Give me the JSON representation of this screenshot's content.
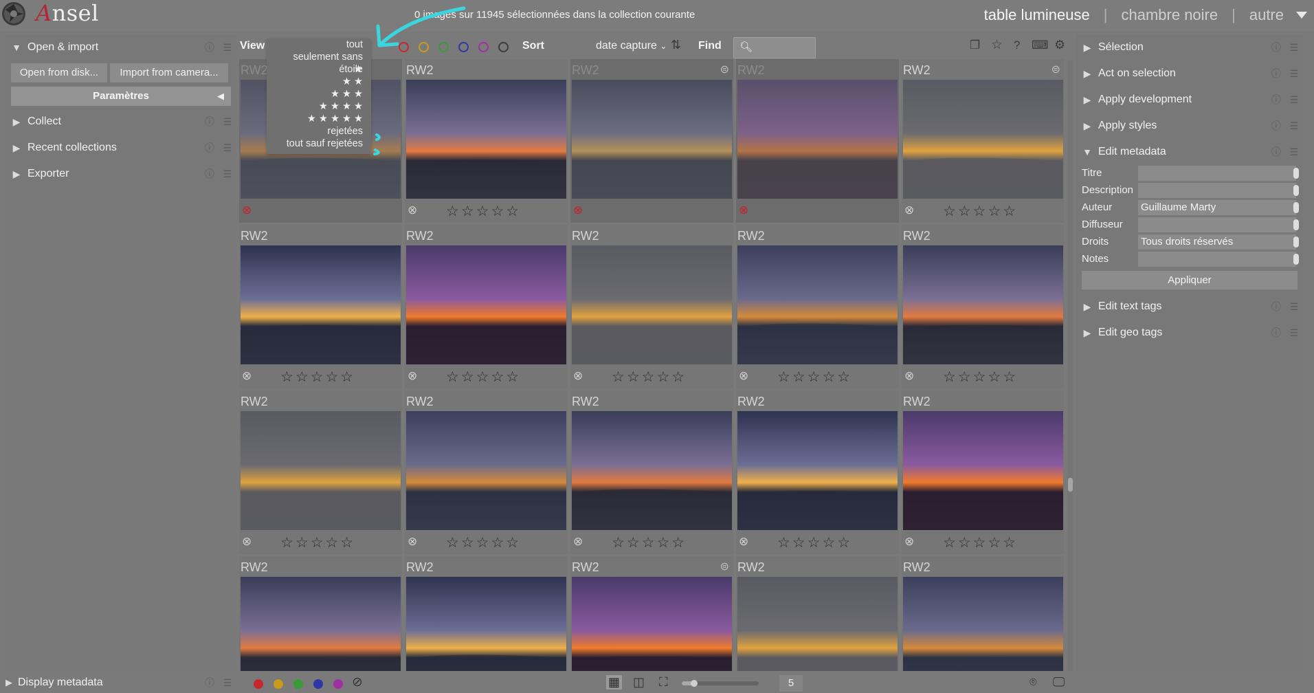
{
  "app": {
    "name_initial": "A",
    "name_rest": "nsel"
  },
  "header": {
    "status": "0 images sur 11945 sélectionnées dans la collection courante",
    "views": [
      "table lumineuse",
      "chambre noire",
      "autre"
    ],
    "separator": "|"
  },
  "left_panel": {
    "modules": [
      {
        "label": "Open & import",
        "expanded": true
      },
      {
        "label": "Collect",
        "expanded": false
      },
      {
        "label": "Recent collections",
        "expanded": false
      },
      {
        "label": "Exporter",
        "expanded": false
      }
    ],
    "buttons": {
      "open": "Open from disk...",
      "import": "Import from camera..."
    },
    "params": "Paramètres",
    "bottom_module": "Display metadata"
  },
  "toolbar": {
    "view_label": "View",
    "sort_label": "Sort",
    "sort_value": "date capture",
    "find_label": "Find",
    "search_placeholder": "",
    "color_filters": [
      "#c8262f",
      "#c99a1e",
      "#3a9a36",
      "#2e37a6",
      "#a12ea3",
      "#3b3b3b"
    ]
  },
  "view_dropdown": {
    "items": [
      "tout",
      "seulement sans étoile",
      "★",
      "★ ★",
      "★ ★ ★",
      "★ ★ ★ ★",
      "★ ★ ★ ★ ★",
      "rejetées",
      "tout sauf rejetées"
    ]
  },
  "thumbnails": [
    {
      "ext": "RW2",
      "stars": 0,
      "rejected": true,
      "dimmed": true,
      "grouped": false
    },
    {
      "ext": "RW2",
      "stars": 0,
      "rejected": false,
      "dimmed": false,
      "grouped": false
    },
    {
      "ext": "RW2",
      "stars": 0,
      "rejected": true,
      "dimmed": true,
      "grouped": true
    },
    {
      "ext": "RW2",
      "stars": 0,
      "rejected": true,
      "dimmed": true,
      "grouped": false
    },
    {
      "ext": "RW2",
      "stars": 0,
      "rejected": false,
      "dimmed": false,
      "grouped": true
    },
    {
      "ext": "RW2",
      "stars": 0,
      "rejected": false,
      "dimmed": false,
      "grouped": false
    },
    {
      "ext": "RW2",
      "stars": 0,
      "rejected": false,
      "dimmed": false,
      "grouped": false
    },
    {
      "ext": "RW2",
      "stars": 0,
      "rejected": false,
      "dimmed": false,
      "grouped": false
    },
    {
      "ext": "RW2",
      "stars": 0,
      "rejected": false,
      "dimmed": false,
      "grouped": false
    },
    {
      "ext": "RW2",
      "stars": 0,
      "rejected": false,
      "dimmed": false,
      "grouped": false
    },
    {
      "ext": "RW2",
      "stars": 0,
      "rejected": false,
      "dimmed": false,
      "grouped": false
    },
    {
      "ext": "RW2",
      "stars": 0,
      "rejected": false,
      "dimmed": false,
      "grouped": false
    },
    {
      "ext": "RW2",
      "stars": 0,
      "rejected": false,
      "dimmed": false,
      "grouped": false
    },
    {
      "ext": "RW2",
      "stars": 0,
      "rejected": false,
      "dimmed": false,
      "grouped": false
    },
    {
      "ext": "RW2",
      "stars": 0,
      "rejected": false,
      "dimmed": false,
      "grouped": false
    },
    {
      "ext": "RW2",
      "stars": 0,
      "rejected": false,
      "dimmed": false,
      "grouped": false
    },
    {
      "ext": "RW2",
      "stars": 0,
      "rejected": false,
      "dimmed": false,
      "grouped": false
    },
    {
      "ext": "RW2",
      "stars": 0,
      "rejected": false,
      "dimmed": false,
      "grouped": true
    },
    {
      "ext": "RW2",
      "stars": 0,
      "rejected": false,
      "dimmed": false,
      "grouped": false
    },
    {
      "ext": "RW2",
      "stars": 0,
      "rejected": false,
      "dimmed": false,
      "grouped": false
    }
  ],
  "right_panel": {
    "modules_top": [
      "Sélection",
      "Act on selection",
      "Apply development",
      "Apply styles"
    ],
    "metadata_module": "Edit metadata",
    "metadata_fields": [
      {
        "label": "Titre",
        "value": ""
      },
      {
        "label": "Description",
        "value": ""
      },
      {
        "label": "Auteur",
        "value": "Guillaume Marty"
      },
      {
        "label": "Diffuseur",
        "value": ""
      },
      {
        "label": "Droits",
        "value": "Tous droits réservés"
      },
      {
        "label": "Notes",
        "value": ""
      }
    ],
    "apply_label": "Appliquer",
    "modules_bottom": [
      "Edit text tags",
      "Edit geo tags"
    ]
  },
  "footer": {
    "color_labels": [
      "#c8262f",
      "#c99a1e",
      "#3a9a36",
      "#2e37a6",
      "#a12ea3"
    ],
    "zoom_value": "5",
    "zoom_fraction": 0.15
  }
}
